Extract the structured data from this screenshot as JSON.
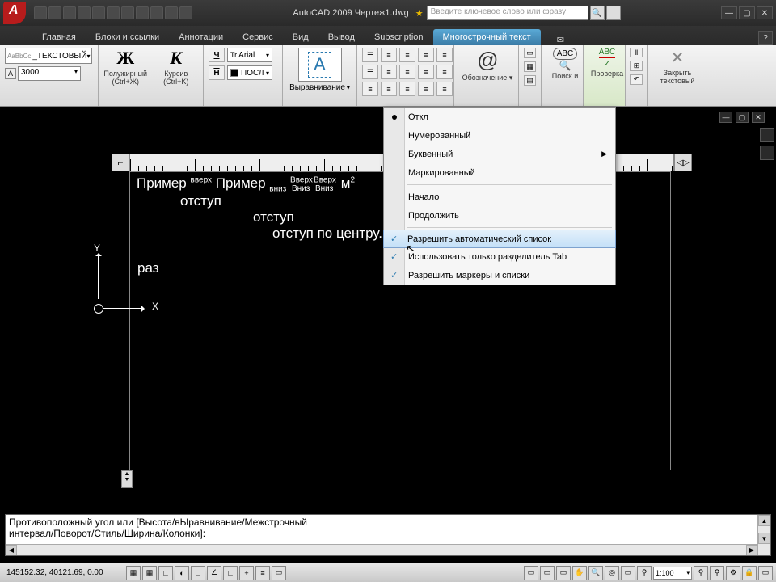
{
  "title": "AutoCAD 2009  Чертеж1.dwg",
  "search_placeholder": "Введите ключевое слово или фразу",
  "tabs": [
    "Главная",
    "Блоки и ссылки",
    "Аннотации",
    "Сервис",
    "Вид",
    "Вывод",
    "Subscription",
    "Многострочный текст"
  ],
  "active_tab": 7,
  "style_combo": "_ТЕКСТОВЫЙ",
  "height_value": "3000",
  "bold": {
    "icon": "Ж",
    "label": "Полужирный",
    "shortcut": "(Ctrl+Ж)"
  },
  "italic": {
    "icon": "К",
    "label": "Курсив (Ctrl+K)"
  },
  "underline_btn": "Ч",
  "overline_btn": "Н",
  "font_name": "Arial",
  "layer_combo": "ПОСЛ",
  "align_label": "Выравнивание",
  "symbol_label": "Обозначение",
  "find_label": "Поиск и",
  "spell_label": "Проверка",
  "close_label": "Закрыть текстовый",
  "dropdown": {
    "items": [
      {
        "label": "Откл",
        "bullet": true
      },
      {
        "label": "Нумерованный"
      },
      {
        "label": "Буквенный",
        "submenu": true
      },
      {
        "label": "Маркированный"
      }
    ],
    "group2": [
      {
        "label": "Начало"
      },
      {
        "label": "Продолжить"
      }
    ],
    "group3": [
      {
        "label": "Разрешить автоматический список",
        "checked": true,
        "hover": true
      },
      {
        "label": "Использовать только разделитель Tab",
        "checked": true
      },
      {
        "label": "Разрешить маркеры и списки",
        "checked": true
      }
    ]
  },
  "canvas_text": {
    "line1_a": "Пример",
    "line1_sup1": "вверх",
    "line1_b": "Пример",
    "line1_sub1": "вниз",
    "line1_sup2": "Вверх",
    "line1_sub2": "Вниз",
    "line1_sup3": "Вверх",
    "line1_sub3": "Вниз",
    "line1_m2": "м",
    "line1_exp": "2",
    "line2": "отступ",
    "line3": "отступ",
    "line4": "отступ по центру.",
    "cursor": "раз"
  },
  "ucs": {
    "x": "X",
    "y": "Y"
  },
  "cmd_line1": "Противоположный угол или [Высота/вЫравнивание/Межстрочный",
  "cmd_line2": "интервал/Поворот/Стиль/Ширина/Колонки]:",
  "coords": "145152.32, 40121.69, 0.00",
  "scale": "1:100",
  "ruler_end": "◁▷"
}
